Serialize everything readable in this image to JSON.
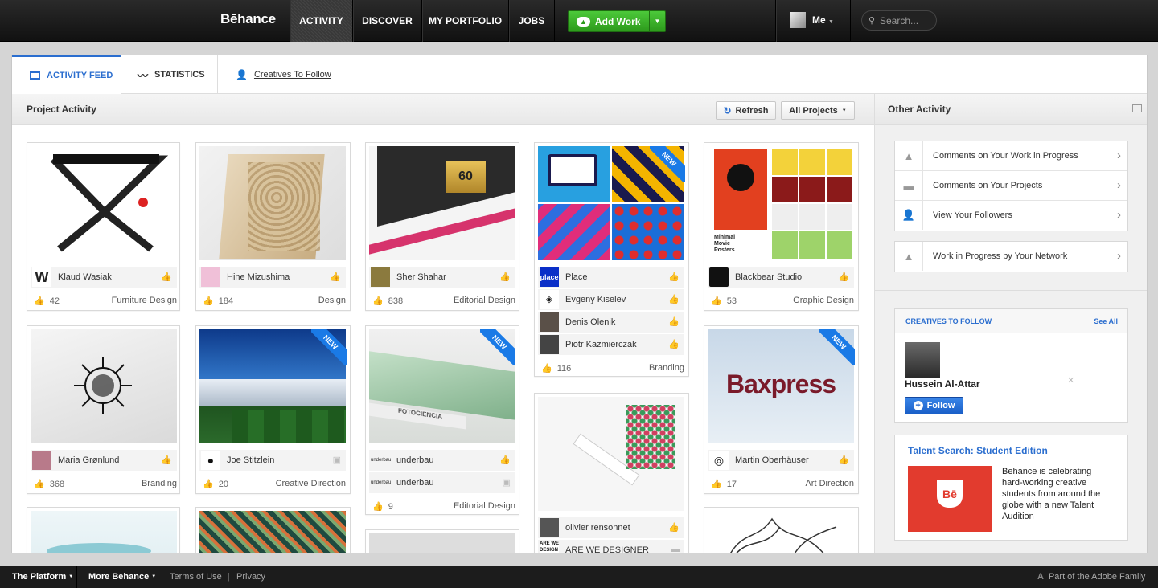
{
  "nav": {
    "logo": "Bēhance",
    "items": [
      "ACTIVITY",
      "DISCOVER",
      "MY PORTFOLIO",
      "JOBS"
    ],
    "add_work": "Add Work",
    "user": "Me",
    "search_placeholder": "Search..."
  },
  "tabs": {
    "activity_feed": "ACTIVITY FEED",
    "statistics": "STATISTICS",
    "creatives_to_follow": "Creatives To Follow"
  },
  "project_activity": {
    "title": "Project Activity",
    "refresh": "Refresh",
    "filter": "All Projects"
  },
  "projects": [
    {
      "owners": [
        "Klaud Wasiak"
      ],
      "likes": "42",
      "category": "Furniture Design",
      "new": false
    },
    {
      "owners": [
        "Hine Mizushima"
      ],
      "likes": "184",
      "category": "Design",
      "new": false
    },
    {
      "owners": [
        "Sher Shahar"
      ],
      "likes": "838",
      "category": "Editorial Design",
      "new": false
    },
    {
      "owners": [
        "Place",
        "Evgeny Kiselev",
        "Denis Olenik",
        "Piotr Kazmierczak"
      ],
      "likes": "116",
      "category": "Branding",
      "new": true
    },
    {
      "owners": [
        "Blackbear Studio"
      ],
      "likes": "53",
      "category": "Graphic Design",
      "new": false
    },
    {
      "owners": [
        "Maria Grønlund"
      ],
      "likes": "368",
      "category": "Branding",
      "new": false
    },
    {
      "owners": [
        "Joe Stitzlein"
      ],
      "likes": "20",
      "category": "Creative Direction",
      "new": true
    },
    {
      "owners": [
        "underbau",
        "underbau"
      ],
      "likes": "9",
      "category": "Editorial Design",
      "new": true
    },
    {
      "owners": [
        "olivier rensonnet",
        "ARE WE DESIGNER"
      ],
      "likes": "",
      "category": "",
      "new": false
    },
    {
      "owners": [
        "Martin Oberhäuser"
      ],
      "likes": "17",
      "category": "Art Direction",
      "new": true
    }
  ],
  "thumb_text": {
    "baxpress": "Baxpress",
    "new": "NEW",
    "place_logo": "place",
    "fotociencia": "FOTOCIENCIA",
    "posters_line1": "Minimal",
    "posters_line2": "Movie",
    "posters_line3": "Posters",
    "book_60": "60",
    "underbau_logo": "underbau"
  },
  "other_activity": {
    "title": "Other Activity",
    "items": [
      "Comments on Your Work in Progress",
      "Comments on Your Projects",
      "View Your Followers"
    ],
    "wip_network": "Work in Progress by Your Network"
  },
  "creatives": {
    "title": "CREATIVES TO FOLLOW",
    "see_all": "See All",
    "name": "Hussein Al-Attar",
    "follow": "Follow"
  },
  "talent": {
    "title": "Talent Search: Student Edition",
    "badge": "Bē",
    "body": "Behance is celebrating hard-working creative students from around the globe with a new Talent Audition"
  },
  "footer": {
    "platform": "The Platform",
    "more": "More Behance",
    "terms": "Terms of Use",
    "privacy": "Privacy",
    "adobe": "Part of the Adobe Family"
  },
  "colors": {
    "accent": "#2b6ecf",
    "green": "#3cb52a",
    "new_ribbon": "#1a7ae6",
    "talent_red": "#e23b2e"
  }
}
